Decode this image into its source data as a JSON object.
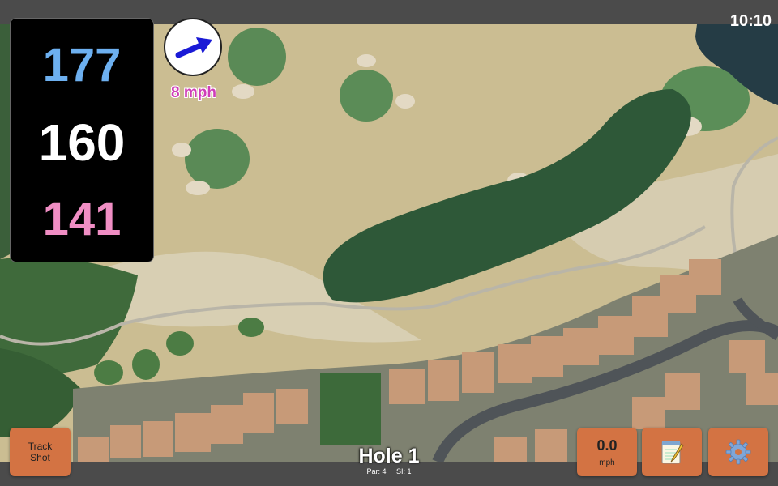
{
  "status": {
    "clock": "10:10"
  },
  "distances": {
    "back": "177",
    "middle": "160",
    "front": "141"
  },
  "wind": {
    "direction_icon": "wind-arrow-icon",
    "speed": "8 mph"
  },
  "buttons": {
    "track_shot_line1": "Track",
    "track_shot_line2": "Shot",
    "wind_value": "0.0",
    "wind_unit": "mph",
    "notes_icon": "notepad-icon",
    "settings_icon": "gear-icon"
  },
  "hole": {
    "title": "Hole 1",
    "par": "Par: 4",
    "si": "SI: 1"
  },
  "colors": {
    "back_distance": "#6db0f0",
    "middle_distance": "#ffffff",
    "front_distance": "#f08ec4",
    "wind_text": "#cf3db8",
    "button": "#d37343",
    "fairway": "#2f5a3a",
    "rough": "#c9bb90"
  }
}
